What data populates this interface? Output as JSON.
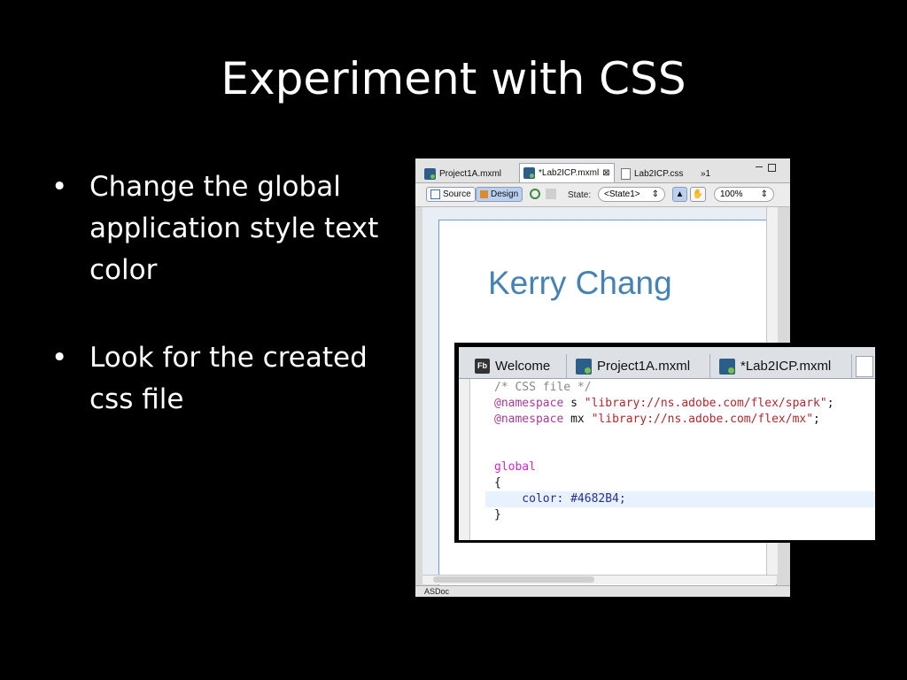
{
  "slide": {
    "title": "Experiment with CSS",
    "bullets": [
      {
        "marker": "•",
        "text": "Change the global application style text color"
      },
      {
        "marker": "•",
        "text": "Look for the created css file"
      }
    ]
  },
  "ide": {
    "tabs": [
      {
        "label": "Project1A.mxml",
        "icon": "mxml-file-icon"
      },
      {
        "label": "*Lab2ICP.mxml",
        "icon": "mxml-file-icon",
        "close": "⊠",
        "active": true
      },
      {
        "label": "Lab2ICP.css",
        "icon": "css-file-icon"
      },
      {
        "label": "»1",
        "icon": "overflow-icon"
      }
    ],
    "toolbar": {
      "source_label": "Source",
      "design_label": "Design",
      "state_label": "State:",
      "state_value": "<State1>",
      "zoom_value": "100%"
    },
    "canvas_text": "Kerry Chang",
    "bottom_tab": "ASDoc"
  },
  "editor": {
    "tabs": [
      {
        "label": "Welcome",
        "icon": "fb-icon",
        "icon_text": "Fb"
      },
      {
        "label": "Project1A.mxml",
        "icon": "mxml-file-icon"
      },
      {
        "label": "*Lab2ICP.mxml",
        "icon": "mxml-file-icon"
      }
    ],
    "code": {
      "line1": "/* CSS file */",
      "line2_at": "@namespace",
      "line2_prefix": " s ",
      "line2_str": "\"library://ns.adobe.com/flex/spark\"",
      "line2_end": ";",
      "line3_at": "@namespace",
      "line3_prefix": " mx ",
      "line3_str": "\"library://ns.adobe.com/flex/mx\"",
      "line3_end": ";",
      "selector": "global",
      "open_brace": "{",
      "prop": "    color: ",
      "value": "#4682B4;",
      "close_brace": "}"
    }
  },
  "colors": {
    "background": "#000000",
    "text": "#ffffff",
    "kerry_color": "#4682B4"
  }
}
